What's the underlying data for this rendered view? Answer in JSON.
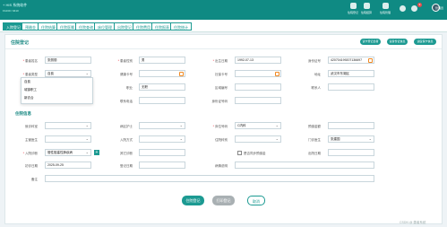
{
  "header": {
    "logo": "+ HIS 系统软件",
    "logo_sub": "F1230 / 0410",
    "tools": [
      {
        "label": "住院登记",
        "icon": "register-icon"
      },
      {
        "label": "住院结算",
        "icon": "settlement-icon"
      },
      {
        "label": "住院管理",
        "icon": "manage-icon"
      }
    ],
    "badge": "9",
    "user": "管理员"
  },
  "tabs": [
    "入院登记",
    "预缴金",
    "住院结算",
    "住院医嘱",
    "住院查询",
    "床位管理",
    "出院登记",
    "住院费用",
    "住院报表",
    "住院统计"
  ],
  "panel": {
    "title": "住院登记",
    "header_buttons": [
      "读卡登记患者",
      "读身份证信息",
      "读医保卡信息"
    ]
  },
  "form": {
    "name_label": "患者姓名",
    "name_value": "张丽丽",
    "gender_label": "患者性别",
    "gender_value": "男",
    "birth_label": "出生日期",
    "birth_value": "1992-07-13",
    "id_label": "身份证号",
    "id_value": "420704199207136697",
    "type_label": "患者类型",
    "type_value": "自费",
    "health_card_label": "健康卡号",
    "social_label": "社保卡号",
    "address_label": "地址",
    "address_value": "武汉市东湖区",
    "work_label": "工作单位",
    "job_label": "职业",
    "job_value": "无职",
    "area_label": "区域编号",
    "contact_label": "联系人",
    "phone_label": "联系电话",
    "relation_label": "联系电话",
    "other_label": "身份证号码"
  },
  "dropdown": {
    "options": [
      "自费",
      "城镇职工",
      "新农合"
    ]
  },
  "hosp": {
    "section_title": "住院信息",
    "dept_label": "就诊科室",
    "ward_label": "病区护士",
    "bed_label": "床位号码",
    "bed_value": "C内科",
    "prepay_label": "预缴金额",
    "doctor_label": "主管医生",
    "admit_way_label": "入院方式",
    "diag_label": "住院科别",
    "clinic_doc_label": "门诊医生",
    "clinic_doc_value": "张建国",
    "admit_diag_label": "入院诊断",
    "admit_diag_value": "慢性阻塞性肺疾病",
    "sec_diag_label": "其它诊断",
    "is_sync_label": "是否同步预缴金",
    "discharge_label": "出院日期",
    "first_date_label": "初诊日期",
    "first_date_value": "2025-09-25",
    "reg_date_label": "登记日期",
    "reason_label": "病情说明",
    "remark_label": "备注"
  },
  "footer": {
    "save": "住院登记",
    "print": "打印登记",
    "cancel": "取消"
  },
  "watermark": "CSDN @ 患者系统",
  "colors": {
    "primary": "#1c9a92",
    "topbar": "#0f8a83",
    "required": "#e23333",
    "accent": "#f08a24"
  }
}
